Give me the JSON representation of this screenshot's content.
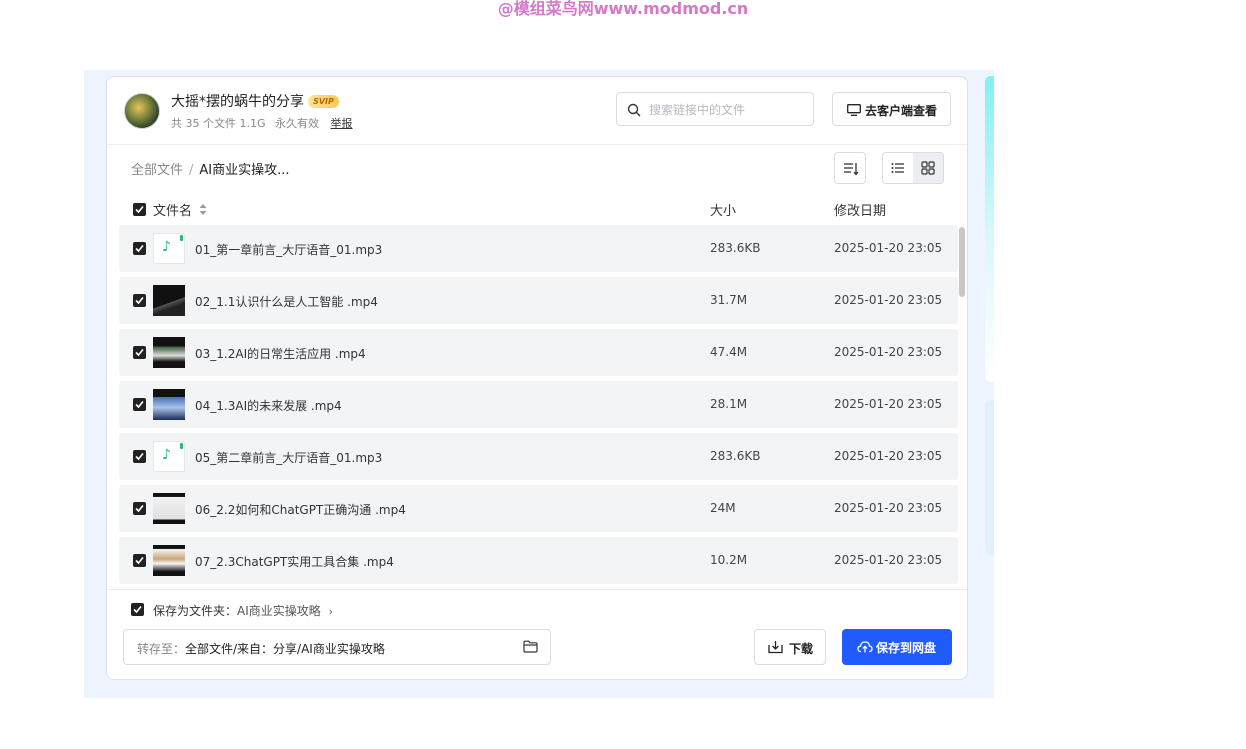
{
  "watermark": "@模组菜鸟网www.modmod.cn",
  "share": {
    "title": "大摇*摆的蜗牛的分享",
    "badge": "SVIP",
    "file_count": "共 35 个文件 1.1G",
    "validity": "永久有效",
    "report": "举报"
  },
  "search": {
    "placeholder": "搜索链接中的文件"
  },
  "client_button": "去客户端查看",
  "breadcrumb": {
    "root": "全部文件",
    "separator": "/",
    "current": "AI商业实操攻..."
  },
  "columns": {
    "name": "文件名",
    "size": "大小",
    "date": "修改日期"
  },
  "files": [
    {
      "name": "01_第一章前言_大厅语音_01.mp3",
      "size": "283.6KB",
      "date": "2025-01-20 23:05",
      "type": "audio"
    },
    {
      "name": "02_1.1认识什么是人工智能 .mp4",
      "size": "31.7M",
      "date": "2025-01-20 23:05",
      "type": "video"
    },
    {
      "name": "03_1.2AI的日常生活应用 .mp4",
      "size": "47.4M",
      "date": "2025-01-20 23:05",
      "type": "video"
    },
    {
      "name": "04_1.3AI的未来发展 .mp4",
      "size": "28.1M",
      "date": "2025-01-20 23:05",
      "type": "video"
    },
    {
      "name": "05_第二章前言_大厅语音_01.mp3",
      "size": "283.6KB",
      "date": "2025-01-20 23:05",
      "type": "audio"
    },
    {
      "name": "06_2.2如何和ChatGPT正确沟通 .mp4",
      "size": "24M",
      "date": "2025-01-20 23:05",
      "type": "video"
    },
    {
      "name": "07_2.3ChatGPT实用工具合集 .mp4",
      "size": "10.2M",
      "date": "2025-01-20 23:05",
      "type": "video"
    }
  ],
  "footer": {
    "save_as_folder_label": "保存为文件夹：",
    "save_as_folder_name": "AI商业实操攻略",
    "dest_label": "转存至：",
    "dest_path": "全部文件/来自：分享/AI商业实操攻略",
    "download_label": "下载",
    "save_label": "保存到网盘"
  },
  "colors": {
    "primary": "#1f5bff",
    "watermark": "#d678c8",
    "audio_icon": "#2bb673"
  }
}
